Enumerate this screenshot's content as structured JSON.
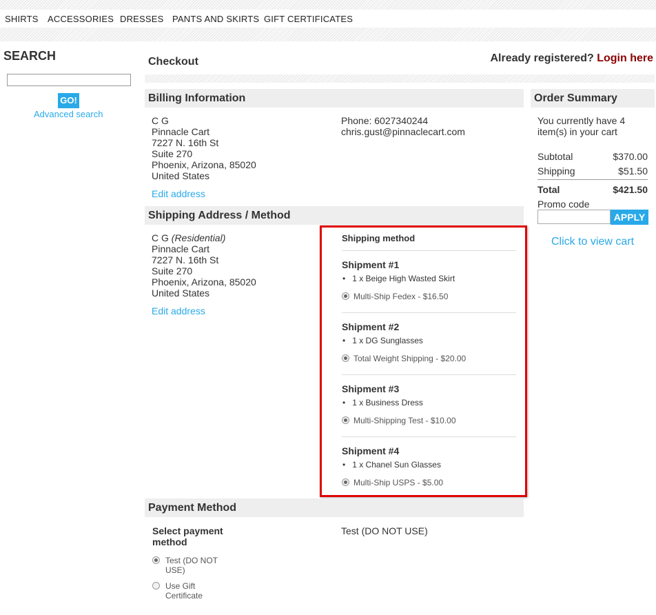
{
  "nav": {
    "items": [
      "SHIRTS",
      "ACCESSORIES",
      "DRESSES",
      "PANTS AND SKIRTS",
      "GIFT CERTIFICATES"
    ]
  },
  "search": {
    "title": "SEARCH",
    "input_value": "",
    "go_label": "GO!",
    "advanced_label": "Advanced search"
  },
  "checkout": {
    "title": "Checkout",
    "already_registered": "Already registered?",
    "login_label": "Login here"
  },
  "billing": {
    "heading": "Billing Information",
    "address_lines": [
      "C G",
      "Pinnacle Cart",
      "7227 N. 16th St",
      "Suite 270",
      "Phoenix, Arizona, 85020",
      "United States"
    ],
    "phone": "Phone: 6027340244",
    "email": "chris.gust@pinnaclecart.com",
    "edit_label": "Edit address"
  },
  "shipping": {
    "heading": "Shipping Address / Method",
    "name": "C G",
    "address_type": "(Residential)",
    "address_lines": [
      "Pinnacle Cart",
      "7227 N. 16th St",
      "Suite 270",
      "Phoenix, Arizona, 85020",
      "United States"
    ],
    "edit_label": "Edit address",
    "method_label": "Shipping method",
    "shipments": [
      {
        "title": "Shipment #1",
        "item": "1 x Beige High Wasted Skirt",
        "option": "Multi-Ship Fedex - $16.50"
      },
      {
        "title": "Shipment #2",
        "item": "1 x DG Sunglasses",
        "option": "Total Weight Shipping - $20.00"
      },
      {
        "title": "Shipment #3",
        "item": "1 x Business Dress",
        "option": "Multi-Shipping Test - $10.00"
      },
      {
        "title": "Shipment #4",
        "item": "1 x Chanel Sun Glasses",
        "option": "Multi-Ship USPS - $5.00"
      }
    ]
  },
  "payment": {
    "heading": "Payment Method",
    "select_label_1": "Select payment",
    "select_label_2": "method",
    "options": [
      {
        "line1": "Test (DO NOT",
        "line2": "USE)",
        "selected": true
      },
      {
        "line1": "Use Gift",
        "line2": "Certificate",
        "selected": false
      }
    ],
    "selected_display": "Test (DO NOT USE)"
  },
  "summary": {
    "heading": "Order Summary",
    "cart_text_1": "You currently have 4",
    "cart_text_2": "item(s) in your cart",
    "subtotal_label": "Subtotal",
    "subtotal_value": "$370.00",
    "shipping_label": "Shipping",
    "shipping_value": "$51.50",
    "total_label": "Total",
    "total_value": "$421.50",
    "promo_label": "Promo code",
    "promo_value": "",
    "apply_label": "APPLY",
    "view_cart_label": "Click to view cart"
  },
  "colors": {
    "accent": "#29a9e8",
    "login": "#8b0000",
    "highlight_border": "#e00000",
    "section_bg": "#eeeeee"
  }
}
